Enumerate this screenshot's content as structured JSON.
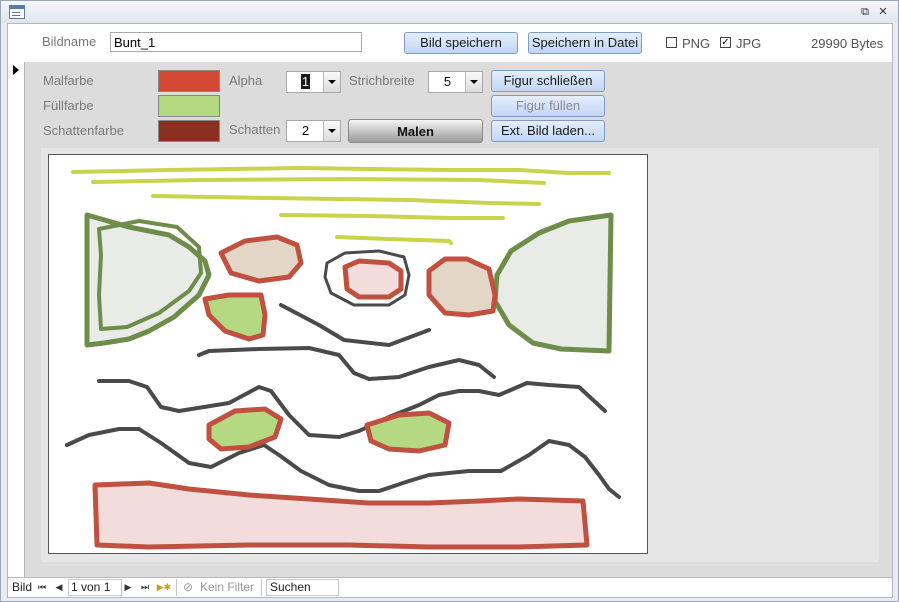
{
  "window": {
    "restore_glyph": "⧉",
    "close_glyph": "✕"
  },
  "header": {
    "bildname_label": "Bildname",
    "bildname_value": "Bunt_1",
    "save_image_label": "Bild speichern",
    "save_file_label": "Speichern in Datei",
    "png_label": "PNG",
    "png_checked": false,
    "jpg_label": "JPG",
    "jpg_checked": true,
    "check_mark": "✓",
    "size_text": "29990 Bytes"
  },
  "controls": {
    "malfarbe_label": "Malfarbe",
    "fuellfarbe_label": "Füllfarbe",
    "schattenfarbe_label": "Schattenfarbe",
    "alpha_label": "Alpha",
    "alpha_value": "1",
    "strichbreite_label": "Strichbreite",
    "strichbreite_value": "5",
    "schatten_label": "Schatten",
    "schatten_value": "2",
    "malen_label": "Malen",
    "figur_schliessen_label": "Figur schließen",
    "figur_fuellen_label": "Figur füllen",
    "ext_bild_label": "Ext. Bild laden..."
  },
  "colors": {
    "malfarbe": "#d34832",
    "fuellfarbe": "#b5d982",
    "schattenfarbe": "#8b3020",
    "stroke_yellow": "#c8d44a",
    "stroke_green": "#6e8c4a",
    "stroke_red": "#c05040",
    "stroke_gray": "#4a4a4a",
    "fill_gray": "#e8ebe6",
    "fill_beige": "#e3d6c6",
    "fill_pink": "#f2dcdc",
    "fill_green": "#b5d982"
  },
  "statusbar": {
    "record_label": "Bild",
    "first_glyph": "⏮",
    "prev_glyph": "◀",
    "record_position": "1 von 1",
    "next_glyph": "▶",
    "last_glyph": "⏭",
    "new_glyph": "▶✱",
    "filter_glyph": "⊘",
    "filter_label": "Kein Filter",
    "search_placeholder": "Suchen"
  }
}
